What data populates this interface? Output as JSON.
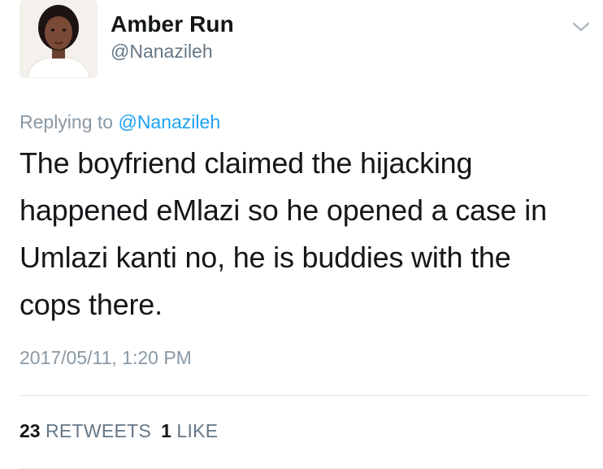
{
  "tweet": {
    "author": {
      "display_name": "Amber Run",
      "handle": "@Nanazileh",
      "avatar_icon": "profile-photo"
    },
    "menu_icon": "chevron-down-icon",
    "reply_context": {
      "prefix": "Replying to",
      "mention": "@Nanazileh"
    },
    "text_lines": [
      "The boyfriend claimed the hijacking",
      "happened eMlazi so he opened a case in",
      "Umlazi kanti no, he is buddies with the",
      "cops there."
    ],
    "timestamp": "2017/05/11, 1:20 PM",
    "stats": {
      "retweets": {
        "count": "23",
        "label": "RETWEETS"
      },
      "likes": {
        "count": "1",
        "label": "LIKE"
      }
    }
  },
  "colors": {
    "text_primary": "#14171a",
    "text_secondary": "#657786",
    "text_muted": "#8899a6",
    "link": "#1da1f2",
    "divider": "#e1e8ed"
  }
}
